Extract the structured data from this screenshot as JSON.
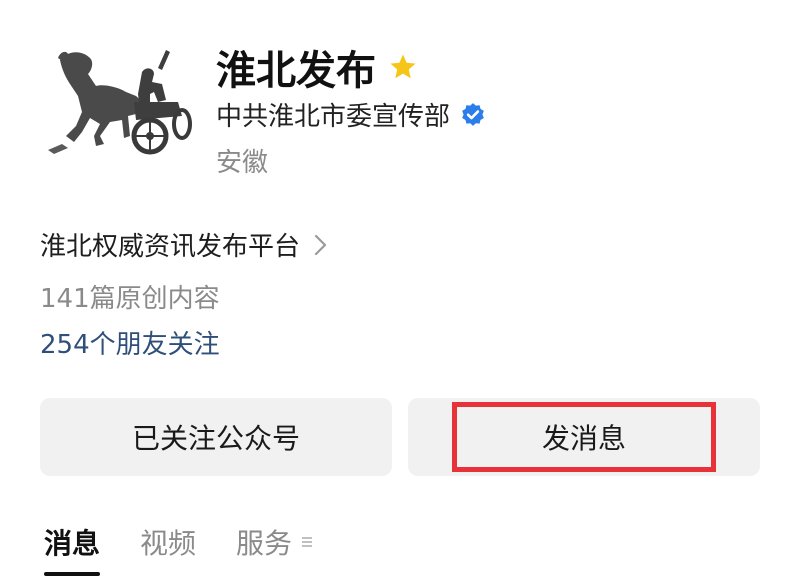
{
  "profile": {
    "name": "淮北发布",
    "organization": "中共淮北市委宣传部",
    "region": "安徽",
    "description": "淮北权威资讯发布平台",
    "article_count": "141篇原创内容",
    "followers": "254个朋友关注",
    "avatar_icon": "horse-chariot-statue-icon",
    "star_icon": "star-icon",
    "verified_icon": "verified-badge-icon"
  },
  "actions": {
    "follow_label": "已关注公众号",
    "message_label": "发消息"
  },
  "tabs": [
    {
      "label": "消息",
      "active": true
    },
    {
      "label": "视频",
      "active": false
    },
    {
      "label": "服务",
      "active": false
    }
  ],
  "colors": {
    "star": "#f5c518",
    "verified": "#2b7de9",
    "followers_text": "#2f4f7a",
    "highlight_box": "#e8323a",
    "button_bg": "#f1f1f1"
  }
}
